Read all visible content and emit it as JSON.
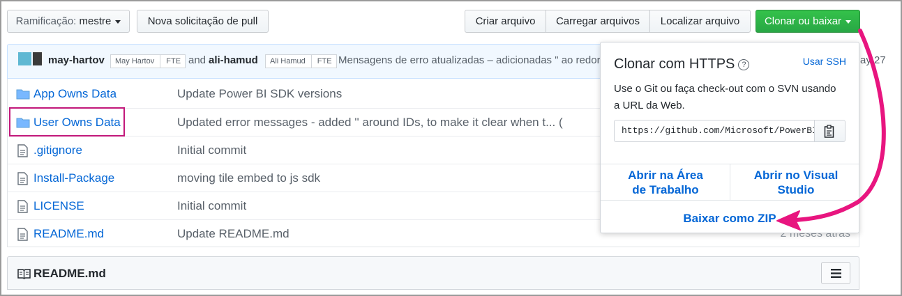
{
  "toolbar": {
    "branch_prefix": "Ramificação:",
    "branch_name": "mestre",
    "new_pull": "Nova solicitação de pull",
    "create_file": "Criar arquivo",
    "upload_files": "Carregar arquivos",
    "find_file": "Localizar arquivo",
    "clone": "Clonar ou baixar"
  },
  "commit": {
    "author1": "may-hartov",
    "author1_tag": "May Hartov",
    "author1_fte": "FTE",
    "and": "and",
    "author2": "ali-hamud",
    "author2_tag": "Ali Hamud",
    "author2_fte": "FTE",
    "message": "Mensagens de erro atualizadas – adicionadas \" ao redor",
    "date_partial": "ay 27"
  },
  "files": [
    {
      "name": "App Owns Data",
      "type": "folder",
      "message": "Update Power BI SDK versions",
      "time": ""
    },
    {
      "name": "User Owns Data",
      "type": "folder",
      "message": "Updated error messages - added '' around IDs, to make it clear when t... (",
      "time": ""
    },
    {
      "name": ".gitignore",
      "type": "file",
      "message": "Initial commit",
      "time": ""
    },
    {
      "name": "Install-Package",
      "type": "file",
      "message": "moving tile embed to js sdk",
      "time": ""
    },
    {
      "name": "LICENSE",
      "type": "file",
      "message": "Initial commit",
      "time": ""
    },
    {
      "name": "README.md",
      "type": "file",
      "message": "Update README.md",
      "time": "2 meses atrás"
    }
  ],
  "readme": {
    "title": "README.md"
  },
  "clone_popover": {
    "title": "Clonar com HTTPS",
    "help": "?",
    "use_ssh": "Usar SSH",
    "description": "Use o Git ou faça check-out com o SVN usando a URL da Web.",
    "url": "https://github.com/Microsoft/PowerBI-Developer-Samples.git",
    "open_desktop": "Abrir na Área de Trabalho",
    "open_vs": "Abrir no Visual Studio",
    "download_zip": "Baixar como ZIP"
  },
  "colors": {
    "accent_link": "#0366d6",
    "clone_button": "#28a745",
    "annotation": "#e8157f"
  }
}
